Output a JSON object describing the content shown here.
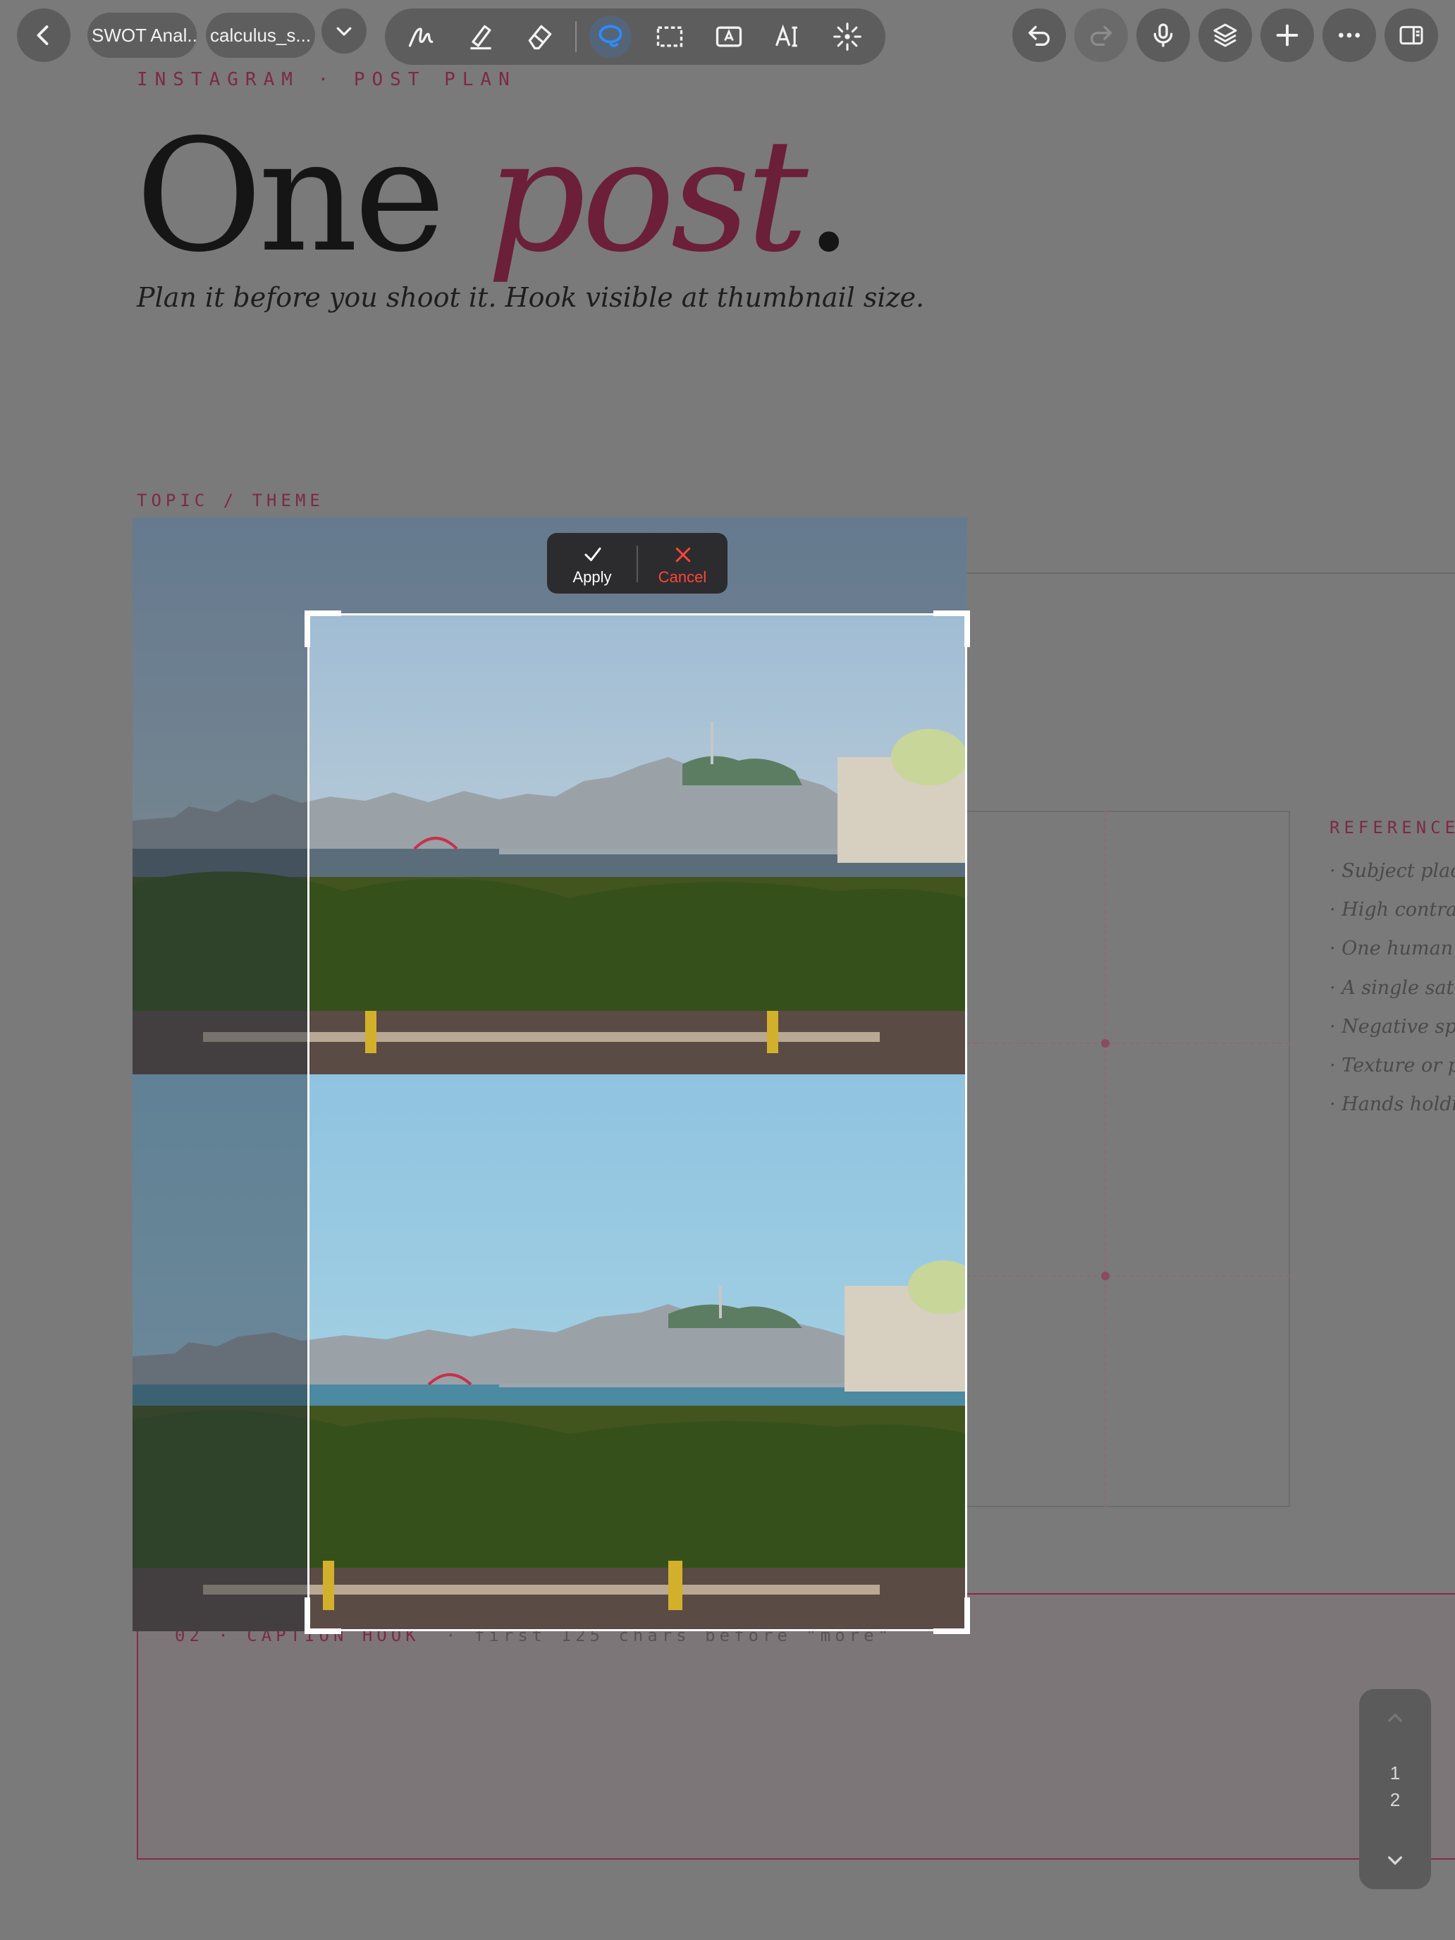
{
  "toolbar": {
    "tabs": [
      "SWOT Anal...",
      "calculus_s..."
    ],
    "active_tool": "lasso-tool",
    "accent_color": "#2d8cff"
  },
  "page": {
    "eyebrow": "INSTAGRAM · POST PLAN",
    "headline_plain": "One ",
    "headline_accent": "post",
    "headline_end": ".",
    "subhead": "Plan it before you shoot it. Hook visible at thumbnail size.",
    "topic_label": "TOPIC / THEME",
    "reference_label": "REFERENCE",
    "reference_items": [
      "· Subject placed",
      "· High contrast",
      "· One human fa",
      "· A single satur",
      "· Negative spac",
      "· Texture or pa",
      "· Hands holdin"
    ],
    "caption_label": "02 · CAPTION HOOK",
    "caption_hint": "· first 125 chars before \"more\"",
    "brand_color": "#7c2a44"
  },
  "crop": {
    "apply_label": "Apply",
    "cancel_label": "Cancel",
    "cancel_color": "#ff453a"
  },
  "pager": {
    "pages": [
      "1",
      "2"
    ]
  }
}
